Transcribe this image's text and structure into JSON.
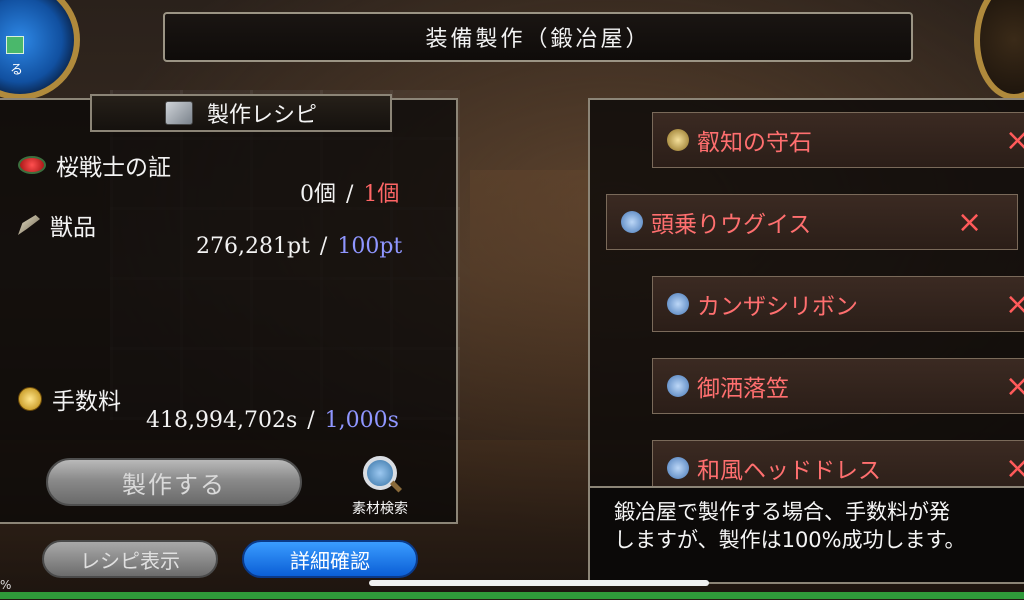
{
  "header": {
    "title": "装備製作（鍛冶屋）"
  },
  "medallion": {
    "label": "る"
  },
  "recipe": {
    "title": "製作レシピ",
    "materials": [
      {
        "name": "桜戦士の証",
        "icon": "red-seal-icon",
        "have": "0個",
        "need": "1個"
      },
      {
        "name": "獣品",
        "icon": "horn-icon",
        "have": "276,281pt",
        "need": "100pt"
      }
    ],
    "fee": {
      "name": "手数料",
      "icon": "coin-icon",
      "have": "418,994,702s",
      "need": "1,000s"
    },
    "separator": "/",
    "craft_button": "製作する",
    "search_label": "素材検索"
  },
  "tabs": {
    "recipe_view": "レシピ表示",
    "detail": "詳細確認"
  },
  "item_list": [
    {
      "name": "叡知の守石",
      "icon": "stone-icon",
      "x": "×"
    },
    {
      "name": "頭乗りウグイス",
      "icon": "bird-icon",
      "x": "×"
    },
    {
      "name": "カンザシリボン",
      "icon": "hat-icon",
      "x": "×"
    },
    {
      "name": "御洒落笠",
      "icon": "hat-icon",
      "x": "×"
    },
    {
      "name": "和風ヘッドドレス",
      "icon": "hat-icon",
      "x": "×"
    }
  ],
  "message": {
    "line1": "鍛冶屋で製作する場合、手数料が発",
    "line2": "しますが、製作は100%成功します。"
  },
  "status": {
    "percent": "%"
  },
  "colors": {
    "need_red": "#ff6666",
    "need_blue": "#8f96ff",
    "item_red": "#ff6f6f",
    "primary_button": "#0b5fd6"
  }
}
